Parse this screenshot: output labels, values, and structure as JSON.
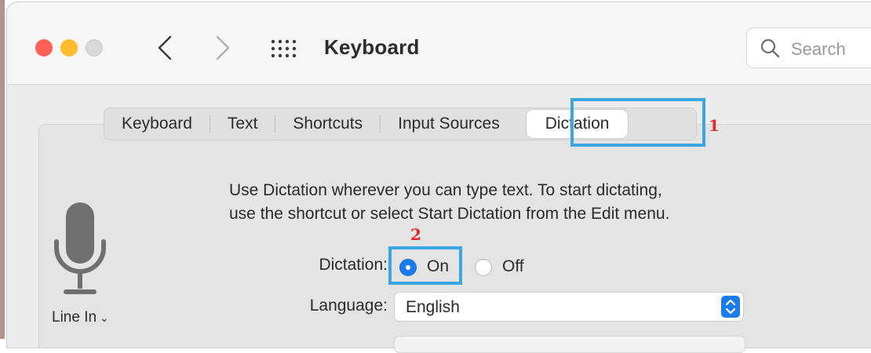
{
  "window": {
    "title": "Keyboard",
    "search_placeholder": "Search"
  },
  "tabs": [
    {
      "label": "Keyboard"
    },
    {
      "label": "Text"
    },
    {
      "label": "Shortcuts"
    },
    {
      "label": "Input Sources"
    },
    {
      "label": "Dictation",
      "selected": true
    }
  ],
  "annotations": {
    "step1": "1",
    "step2": "2",
    "highlight_color": "#3aa6e6",
    "callout_color": "#e0282d"
  },
  "dictation": {
    "description_line1": "Use Dictation wherever you can type text. To start dictating,",
    "description_line2": "use the shortcut or select Start Dictation from the Edit menu.",
    "mic_source": "Line In",
    "dictation_label": "Dictation:",
    "option_on": "On",
    "option_off": "Off",
    "selected": "On",
    "language_label": "Language:",
    "language_value": "English"
  },
  "colors": {
    "accent": "#1a7cf0",
    "close": "#ff5f57",
    "minimize": "#febc2e",
    "zoom_disabled": "#d9d9d9"
  },
  "icons": {
    "back": "chevron-left-icon",
    "forward": "chevron-right-icon",
    "all_prefs": "grid-icon",
    "search": "magnifier-icon",
    "mic": "microphone-icon",
    "dropdown": "chevron-down-icon",
    "stepper": "up-down-stepper-icon"
  }
}
